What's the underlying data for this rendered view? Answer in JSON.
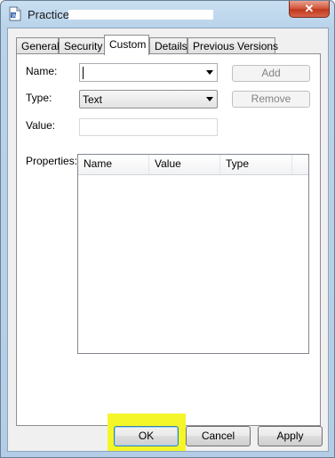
{
  "window": {
    "title": "Practice",
    "close_glyph": "✕"
  },
  "tabs": [
    {
      "label": "General",
      "active": false
    },
    {
      "label": "Security",
      "active": false
    },
    {
      "label": "Custom",
      "active": true
    },
    {
      "label": "Details",
      "active": false
    },
    {
      "label": "Previous Versions",
      "active": false
    }
  ],
  "custom": {
    "name_label": "Name:",
    "name_value": "",
    "type_label": "Type:",
    "type_value": "Text",
    "value_label": "Value:",
    "value_value": "",
    "add_label": "Add",
    "remove_label": "Remove",
    "properties_label": "Properties:",
    "columns": [
      "Name",
      "Value",
      "Type"
    ]
  },
  "footer": {
    "ok_label": "OK",
    "cancel_label": "Cancel",
    "apply_label": "Apply"
  },
  "colors": {
    "highlight": "#f4f62a",
    "default_button_border": "#3c7fb1"
  }
}
